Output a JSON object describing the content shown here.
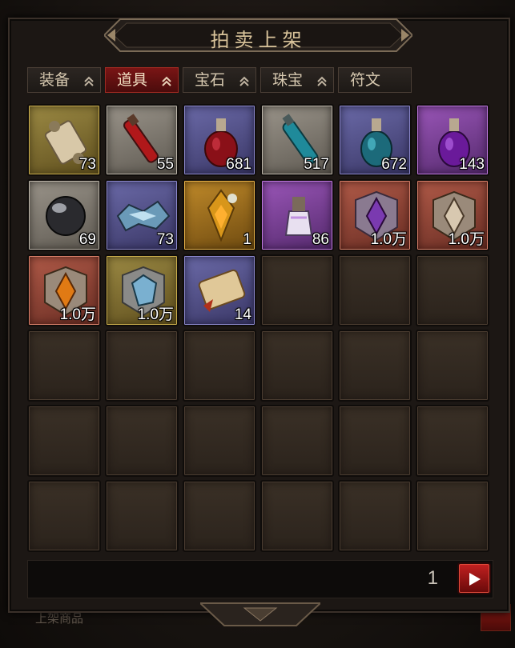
{
  "window": {
    "title": "拍卖上架"
  },
  "tabs": [
    {
      "label": "装备",
      "active": false,
      "has_chevron": true
    },
    {
      "label": "道具",
      "active": true,
      "has_chevron": true
    },
    {
      "label": "宝石",
      "active": false,
      "has_chevron": true
    },
    {
      "label": "珠宝",
      "active": false,
      "has_chevron": true
    },
    {
      "label": "符文",
      "active": false,
      "has_chevron": false
    }
  ],
  "items": [
    {
      "icon": "scroll-icon",
      "rarity": "yellow",
      "qty": "73"
    },
    {
      "icon": "red-vial-icon",
      "rarity": "white",
      "qty": "55"
    },
    {
      "icon": "red-potion-icon",
      "rarity": "blue",
      "qty": "681"
    },
    {
      "icon": "blue-vial-icon",
      "rarity": "white",
      "qty": "517"
    },
    {
      "icon": "blue-potion-icon",
      "rarity": "blue",
      "qty": "672"
    },
    {
      "icon": "purple-potion-icon",
      "rarity": "purple",
      "qty": "143"
    },
    {
      "icon": "black-orb-icon",
      "rarity": "white",
      "qty": "69"
    },
    {
      "icon": "crystal-shard-icon",
      "rarity": "blue",
      "qty": "73"
    },
    {
      "icon": "golden-amulet-icon",
      "rarity": "orange",
      "qty": "1"
    },
    {
      "icon": "lantern-potion-icon",
      "rarity": "purple",
      "qty": "86"
    },
    {
      "icon": "purple-gem-puzzle-icon",
      "rarity": "red",
      "qty": "1.0万"
    },
    {
      "icon": "silver-gem-puzzle-icon",
      "rarity": "red",
      "qty": "1.0万"
    },
    {
      "icon": "orange-gem-puzzle-icon",
      "rarity": "red",
      "qty": "1.0万"
    },
    {
      "icon": "ice-gem-puzzle-icon",
      "rarity": "yellow",
      "qty": "1.0万"
    },
    {
      "icon": "parchment-scroll-icon",
      "rarity": "blue",
      "qty": "14"
    }
  ],
  "empty_slots": 21,
  "pager": {
    "page": "1",
    "next_icon": "play-arrow-icon"
  },
  "colors": {
    "accent_red": "#a02a22",
    "title_gold": "#d9c39a",
    "quantity_text": "#ffffff"
  }
}
